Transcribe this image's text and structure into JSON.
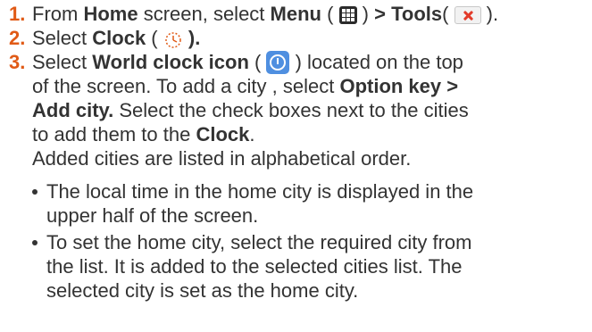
{
  "steps": [
    {
      "number": "1.",
      "t1": "From ",
      "b1": "Home",
      "t2": " screen, select ",
      "b2": "Menu",
      "t3": " ( ",
      "menu_icon": "menu-grid-icon",
      "t4": " ) ",
      "b3": "> Tools",
      "t5": "( ",
      "tools_icon": "tools-icon",
      "t6": " )."
    },
    {
      "number": "2.",
      "t1": "Select ",
      "b1": "Clock",
      "t2": " ( ",
      "clock_icon": "alarm-clock-icon",
      "b2": " )."
    },
    {
      "number": "3.",
      "l1_t1": "Select ",
      "l1_b1": "World clock icon",
      "l1_t2": " ( ",
      "world_icon": "world-clock-icon",
      "l1_t3": " ) located on the top",
      "l2_t1": "of the screen. To add a city , select ",
      "l2_b1": "Option key >",
      "l3_b1": "Add city.",
      "l3_t1": " Select the check boxes next to the cities",
      "l4_t1": "to add them to the ",
      "l4_b1": "Clock",
      "l4_t2": ".",
      "l5_t1": "Added cities are listed in alphabetical order."
    }
  ],
  "bullets": [
    {
      "l1": "The local time in the home city is displayed in the",
      "l2": "upper half of the screen."
    },
    {
      "l1": "To set the home city, select the required city from",
      "l2": "the list. It is added to the selected cities list. The",
      "l3": "selected city is set as the home city."
    }
  ],
  "colors": {
    "step_number": "#e05a16",
    "text": "#333333",
    "world_icon": "#4f8fe0",
    "tools_icon_accent": "#e23b2a"
  }
}
